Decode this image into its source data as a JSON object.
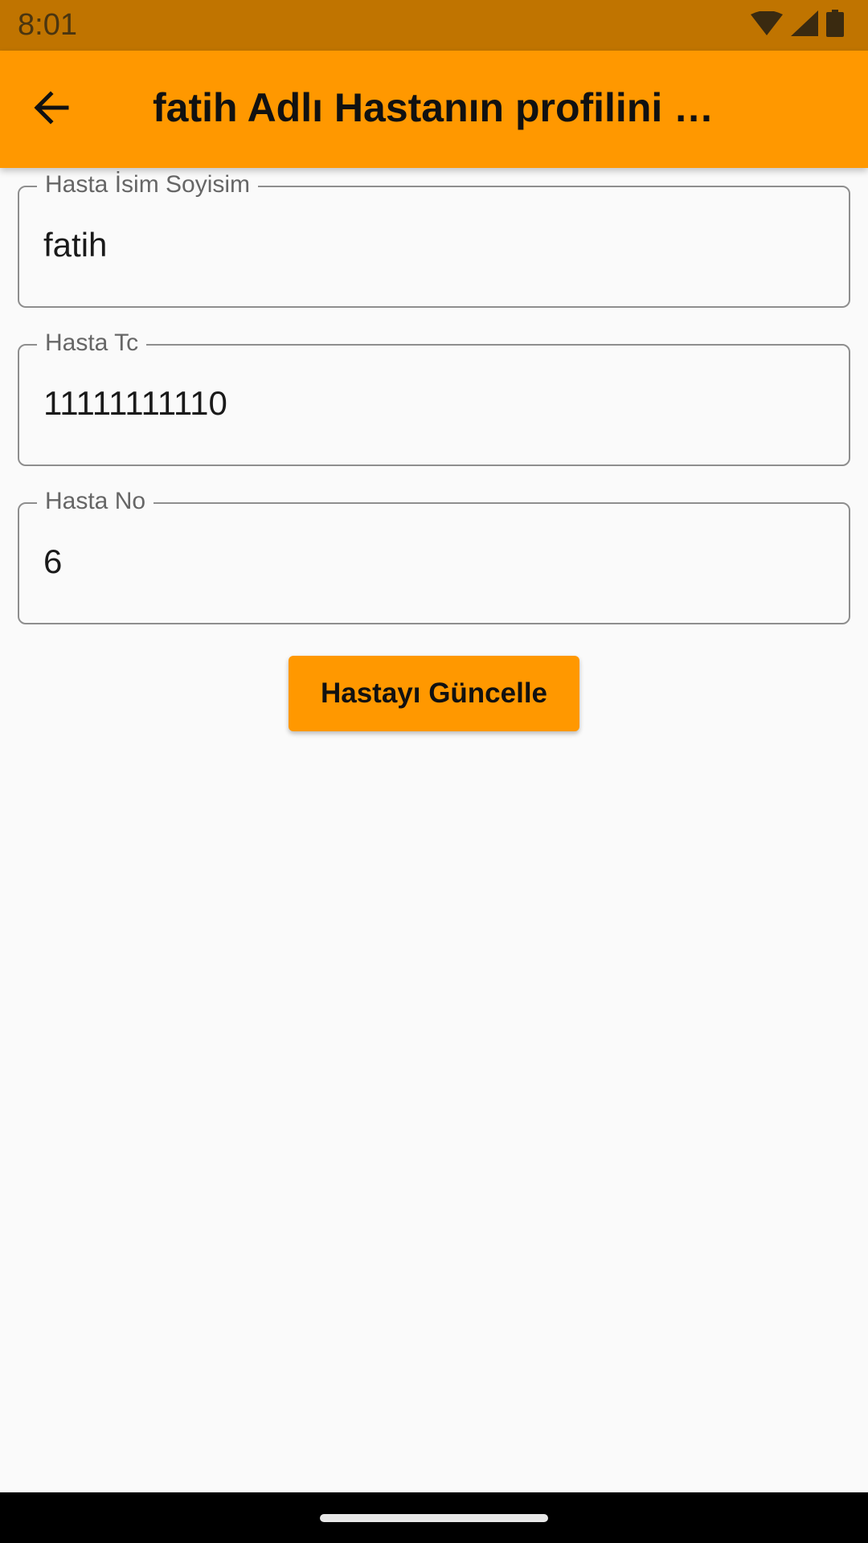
{
  "status_bar": {
    "time": "8:01",
    "icons": [
      "wifi-icon",
      "signal-icon",
      "battery-icon"
    ]
  },
  "app_bar": {
    "back_icon": "arrow-left-icon",
    "title": "fatih Adlı Hastanın profilini düzenle",
    "color": "#ff9800"
  },
  "form": {
    "fields": [
      {
        "label": "Hasta İsim Soyisim",
        "value": "fatih"
      },
      {
        "label": "Hasta Tc",
        "value": "11111111110"
      },
      {
        "label": "Hasta No",
        "value": "6"
      }
    ],
    "submit_label": "Hastayı Güncelle"
  }
}
